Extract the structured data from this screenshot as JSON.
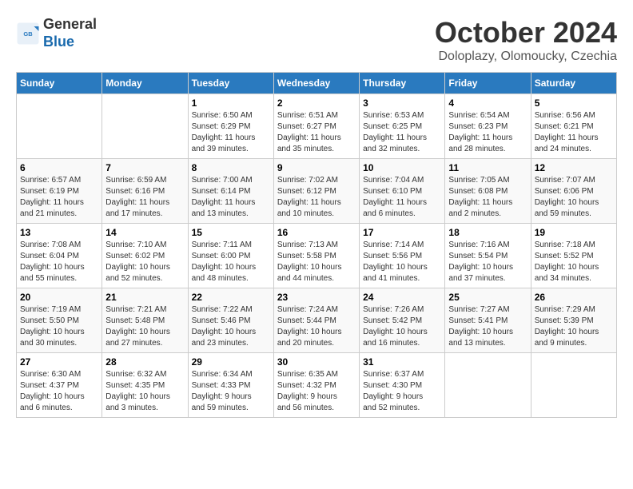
{
  "header": {
    "logo_line1": "General",
    "logo_line2": "Blue",
    "month": "October 2024",
    "location": "Doloplazy, Olomoucky, Czechia"
  },
  "weekdays": [
    "Sunday",
    "Monday",
    "Tuesday",
    "Wednesday",
    "Thursday",
    "Friday",
    "Saturday"
  ],
  "weeks": [
    [
      {
        "day": "",
        "info": ""
      },
      {
        "day": "",
        "info": ""
      },
      {
        "day": "1",
        "info": "Sunrise: 6:50 AM\nSunset: 6:29 PM\nDaylight: 11 hours\nand 39 minutes."
      },
      {
        "day": "2",
        "info": "Sunrise: 6:51 AM\nSunset: 6:27 PM\nDaylight: 11 hours\nand 35 minutes."
      },
      {
        "day": "3",
        "info": "Sunrise: 6:53 AM\nSunset: 6:25 PM\nDaylight: 11 hours\nand 32 minutes."
      },
      {
        "day": "4",
        "info": "Sunrise: 6:54 AM\nSunset: 6:23 PM\nDaylight: 11 hours\nand 28 minutes."
      },
      {
        "day": "5",
        "info": "Sunrise: 6:56 AM\nSunset: 6:21 PM\nDaylight: 11 hours\nand 24 minutes."
      }
    ],
    [
      {
        "day": "6",
        "info": "Sunrise: 6:57 AM\nSunset: 6:19 PM\nDaylight: 11 hours\nand 21 minutes."
      },
      {
        "day": "7",
        "info": "Sunrise: 6:59 AM\nSunset: 6:16 PM\nDaylight: 11 hours\nand 17 minutes."
      },
      {
        "day": "8",
        "info": "Sunrise: 7:00 AM\nSunset: 6:14 PM\nDaylight: 11 hours\nand 13 minutes."
      },
      {
        "day": "9",
        "info": "Sunrise: 7:02 AM\nSunset: 6:12 PM\nDaylight: 11 hours\nand 10 minutes."
      },
      {
        "day": "10",
        "info": "Sunrise: 7:04 AM\nSunset: 6:10 PM\nDaylight: 11 hours\nand 6 minutes."
      },
      {
        "day": "11",
        "info": "Sunrise: 7:05 AM\nSunset: 6:08 PM\nDaylight: 11 hours\nand 2 minutes."
      },
      {
        "day": "12",
        "info": "Sunrise: 7:07 AM\nSunset: 6:06 PM\nDaylight: 10 hours\nand 59 minutes."
      }
    ],
    [
      {
        "day": "13",
        "info": "Sunrise: 7:08 AM\nSunset: 6:04 PM\nDaylight: 10 hours\nand 55 minutes."
      },
      {
        "day": "14",
        "info": "Sunrise: 7:10 AM\nSunset: 6:02 PM\nDaylight: 10 hours\nand 52 minutes."
      },
      {
        "day": "15",
        "info": "Sunrise: 7:11 AM\nSunset: 6:00 PM\nDaylight: 10 hours\nand 48 minutes."
      },
      {
        "day": "16",
        "info": "Sunrise: 7:13 AM\nSunset: 5:58 PM\nDaylight: 10 hours\nand 44 minutes."
      },
      {
        "day": "17",
        "info": "Sunrise: 7:14 AM\nSunset: 5:56 PM\nDaylight: 10 hours\nand 41 minutes."
      },
      {
        "day": "18",
        "info": "Sunrise: 7:16 AM\nSunset: 5:54 PM\nDaylight: 10 hours\nand 37 minutes."
      },
      {
        "day": "19",
        "info": "Sunrise: 7:18 AM\nSunset: 5:52 PM\nDaylight: 10 hours\nand 34 minutes."
      }
    ],
    [
      {
        "day": "20",
        "info": "Sunrise: 7:19 AM\nSunset: 5:50 PM\nDaylight: 10 hours\nand 30 minutes."
      },
      {
        "day": "21",
        "info": "Sunrise: 7:21 AM\nSunset: 5:48 PM\nDaylight: 10 hours\nand 27 minutes."
      },
      {
        "day": "22",
        "info": "Sunrise: 7:22 AM\nSunset: 5:46 PM\nDaylight: 10 hours\nand 23 minutes."
      },
      {
        "day": "23",
        "info": "Sunrise: 7:24 AM\nSunset: 5:44 PM\nDaylight: 10 hours\nand 20 minutes."
      },
      {
        "day": "24",
        "info": "Sunrise: 7:26 AM\nSunset: 5:42 PM\nDaylight: 10 hours\nand 16 minutes."
      },
      {
        "day": "25",
        "info": "Sunrise: 7:27 AM\nSunset: 5:41 PM\nDaylight: 10 hours\nand 13 minutes."
      },
      {
        "day": "26",
        "info": "Sunrise: 7:29 AM\nSunset: 5:39 PM\nDaylight: 10 hours\nand 9 minutes."
      }
    ],
    [
      {
        "day": "27",
        "info": "Sunrise: 6:30 AM\nSunset: 4:37 PM\nDaylight: 10 hours\nand 6 minutes."
      },
      {
        "day": "28",
        "info": "Sunrise: 6:32 AM\nSunset: 4:35 PM\nDaylight: 10 hours\nand 3 minutes."
      },
      {
        "day": "29",
        "info": "Sunrise: 6:34 AM\nSunset: 4:33 PM\nDaylight: 9 hours\nand 59 minutes."
      },
      {
        "day": "30",
        "info": "Sunrise: 6:35 AM\nSunset: 4:32 PM\nDaylight: 9 hours\nand 56 minutes."
      },
      {
        "day": "31",
        "info": "Sunrise: 6:37 AM\nSunset: 4:30 PM\nDaylight: 9 hours\nand 52 minutes."
      },
      {
        "day": "",
        "info": ""
      },
      {
        "day": "",
        "info": ""
      }
    ]
  ]
}
